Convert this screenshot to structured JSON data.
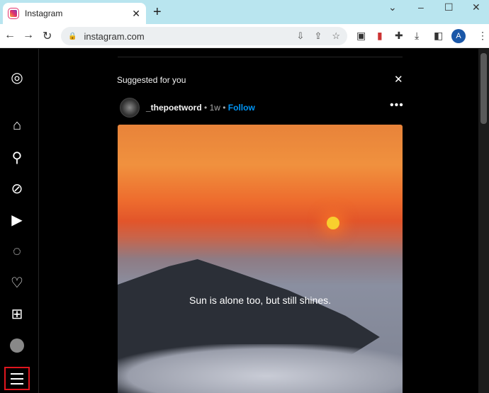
{
  "browser": {
    "tab_title": "Instagram",
    "url": "instagram.com",
    "profile_initial": "A"
  },
  "feed": {
    "section_title": "Suggested for you",
    "username": "_thepoetword",
    "age": "1w",
    "follow_label": "Follow",
    "image_caption": "Sun is alone too, but still shines."
  }
}
